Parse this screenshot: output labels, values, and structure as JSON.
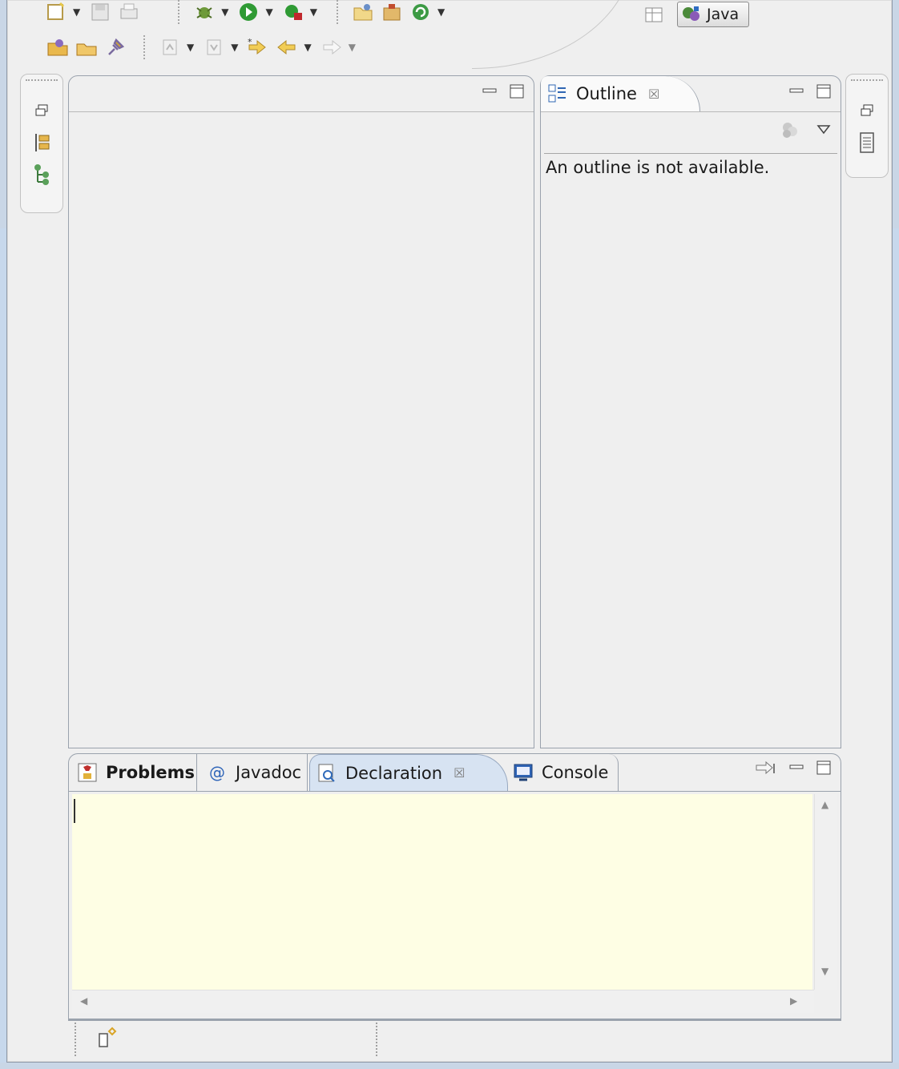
{
  "perspective": {
    "label": "Java"
  },
  "outline": {
    "tab_label": "Outline",
    "message": "An outline is not available."
  },
  "bottom_tabs": [
    {
      "label": "Problems",
      "bold": true
    },
    {
      "label": "Javadoc",
      "prefix": "@"
    },
    {
      "label": "Declaration",
      "active": true
    },
    {
      "label": "Console"
    }
  ],
  "close_glyph": "☒",
  "icons": {
    "toolbar_row1": [
      "new-wizard-icon",
      "save-icon",
      "print-icon",
      "debug-icon",
      "run-icon",
      "external-tools-icon",
      "open-type-icon",
      "open-project-icon",
      "refresh-icon"
    ],
    "toolbar_row2": [
      "open-folder-icon",
      "open-file-icon",
      "pin-icon",
      "next-annotation-icon",
      "prev-annotation-icon",
      "last-edit-icon",
      "back-icon",
      "forward-icon"
    ],
    "left_trim": [
      "restore-icon",
      "hierarchy-icon",
      "tree-icon"
    ],
    "right_trim": [
      "restore-icon",
      "task-list-icon"
    ],
    "status": [
      "new-fast-view-icon"
    ]
  },
  "colors": {
    "declaration_bg": "#fefee4",
    "active_tab": "#d7e3f2",
    "frame": "#c7d8ec"
  }
}
